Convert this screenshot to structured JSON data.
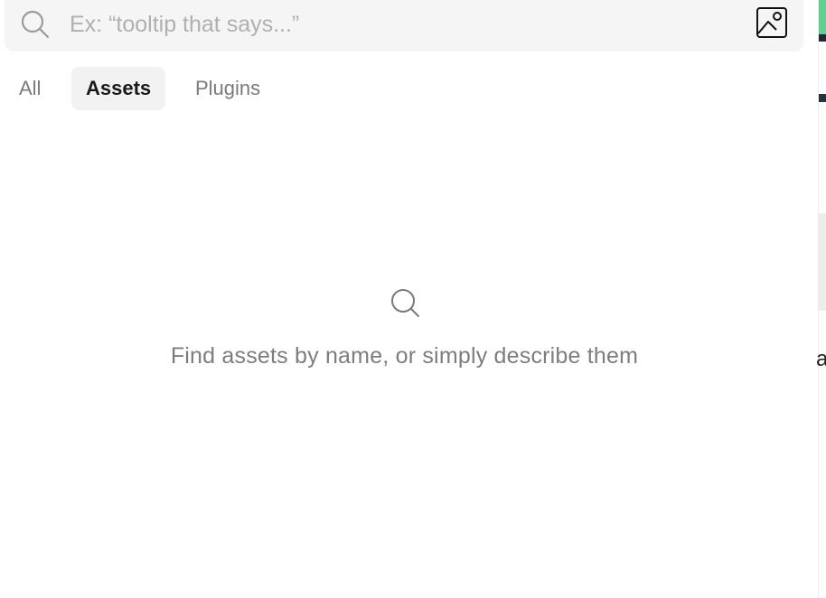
{
  "search": {
    "placeholder": "Ex: “tooltip that says...”",
    "value": "",
    "icon": "search-icon",
    "image_search_icon": "image-search-icon"
  },
  "tabs": [
    {
      "label": "All",
      "active": false
    },
    {
      "label": "Assets",
      "active": true
    },
    {
      "label": "Plugins",
      "active": false
    }
  ],
  "empty_state": {
    "icon": "search-icon",
    "message": "Find assets by name, or simply describe them"
  },
  "background_strip": {
    "visible_text": "a"
  },
  "colors": {
    "search_bg": "#f5f5f5",
    "active_tab_bg": "#f2f2f2",
    "active_tab_text": "#1a1a1a",
    "muted_text": "#7d7d7d",
    "placeholder_text": "#b0b0b0",
    "strip_green": "#5ed08f",
    "strip_dark": "#1f2a33"
  }
}
